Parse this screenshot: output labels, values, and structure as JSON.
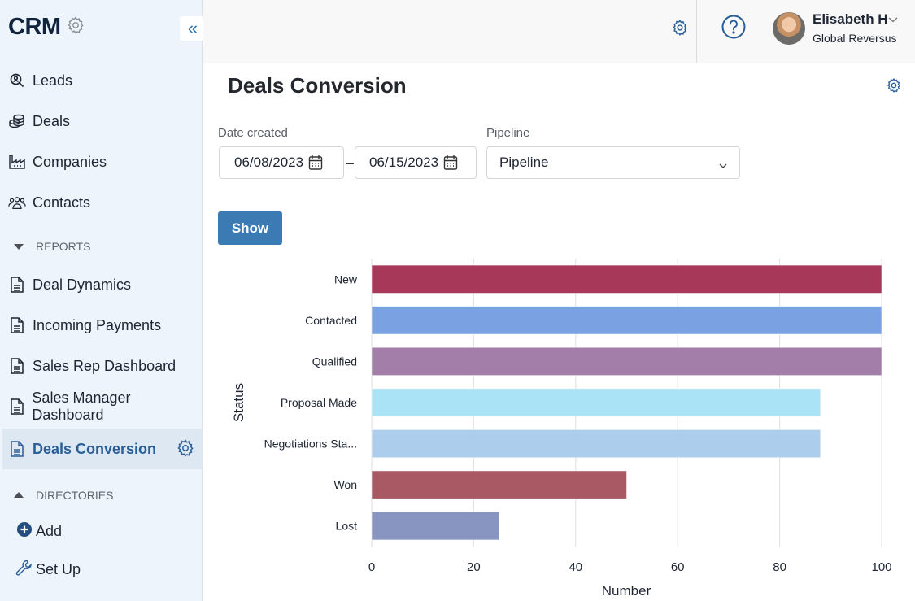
{
  "app": {
    "title": "CRM"
  },
  "sidebar": {
    "items": [
      {
        "label": "Leads",
        "icon": "search-user-icon"
      },
      {
        "label": "Deals",
        "icon": "coins-icon"
      },
      {
        "label": "Companies",
        "icon": "factory-icon"
      },
      {
        "label": "Contacts",
        "icon": "people-icon"
      }
    ],
    "reports_header": "REPORTS",
    "reports": [
      {
        "label": "Deal Dynamics"
      },
      {
        "label": "Incoming Payments"
      },
      {
        "label": "Sales Rep Dashboard"
      },
      {
        "label": "Sales Manager Dashboard"
      },
      {
        "label": "Deals Conversion",
        "active": true
      }
    ],
    "directories_header": "DIRECTORIES",
    "add_label": "Add",
    "setup_label": "Set Up"
  },
  "topbar": {
    "user_name": "Elisabeth H",
    "user_org": "Global Reversus"
  },
  "page": {
    "title": "Deals Conversion",
    "date_label": "Date created",
    "date_from": "06/08/2023",
    "date_separator": "–",
    "date_to": "06/15/2023",
    "pipeline_label": "Pipeline",
    "pipeline_value": "Pipeline",
    "show_button": "Show"
  },
  "chart_data": {
    "type": "bar",
    "orientation": "horizontal",
    "title": "",
    "xlabel": "Number",
    "ylabel": "Status",
    "categories": [
      "New",
      "Contacted",
      "Qualified",
      "Proposal Made",
      "Negotiations Sta...",
      "Won",
      "Lost"
    ],
    "values": [
      100,
      100,
      100,
      88,
      88,
      50,
      25
    ],
    "colors": [
      "#a8385a",
      "#7aa2e3",
      "#a27ea8",
      "#aae3f5",
      "#adcdec",
      "#a95963",
      "#8895c0"
    ],
    "xlim": [
      0,
      100
    ],
    "xticks": [
      0,
      20,
      40,
      60,
      80,
      100
    ],
    "grid": true,
    "legend": "none"
  }
}
